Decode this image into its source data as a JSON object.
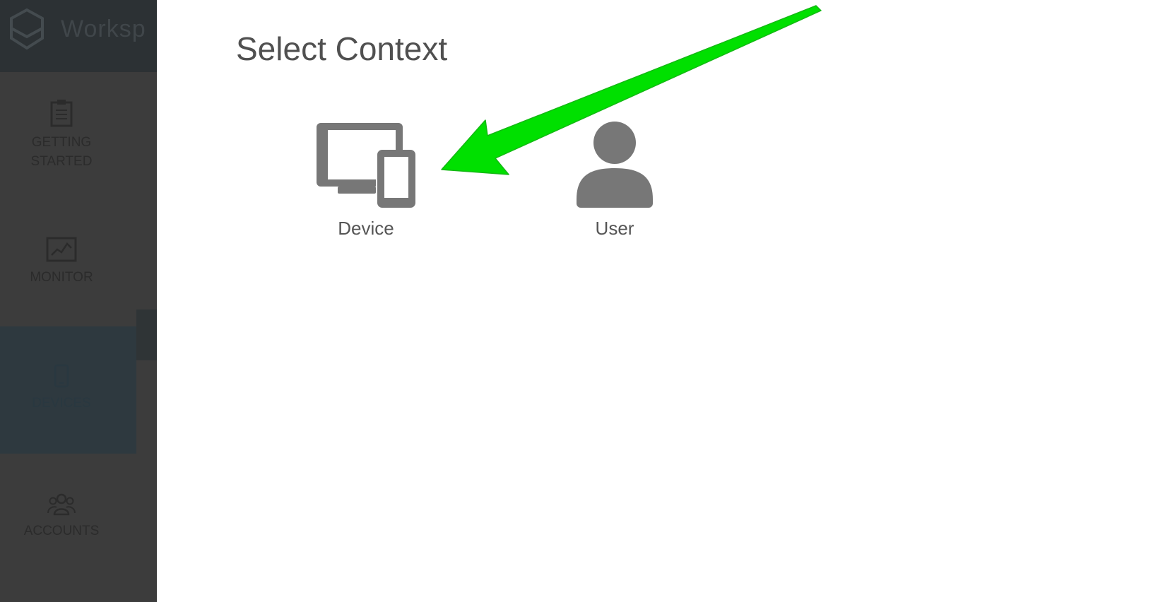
{
  "sidebar": {
    "brand_name": "Worksp",
    "items": [
      {
        "label": "GETTING STARTED",
        "icon": "clipboard-icon"
      },
      {
        "label": "MONITOR",
        "icon": "chart-line-icon"
      },
      {
        "label": "DEVICES",
        "icon": "phone-icon",
        "selected": true
      },
      {
        "label": "ACCOUNTS",
        "icon": "users-icon"
      }
    ]
  },
  "panel": {
    "title": "Select Context",
    "options": [
      {
        "label": "Device",
        "icon": "devices-icon"
      },
      {
        "label": "User",
        "icon": "user-icon"
      }
    ]
  },
  "annotation": {
    "color": "#00e000",
    "icon": "arrow-icon"
  }
}
